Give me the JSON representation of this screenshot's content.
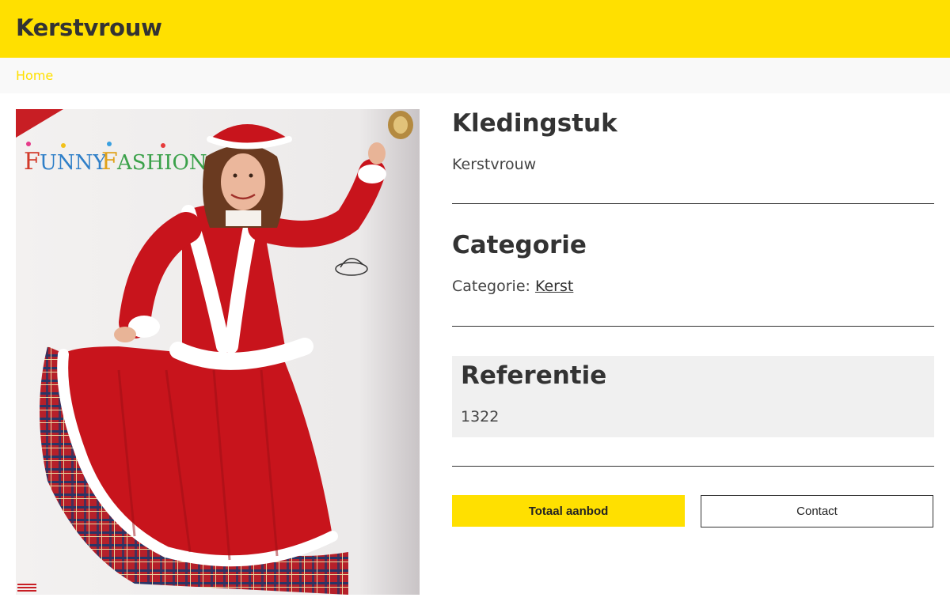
{
  "header": {
    "title": "Kerstvrouw"
  },
  "breadcrumb": {
    "home_label": "Home"
  },
  "photo": {
    "brand_text": "FUNNY FASHION"
  },
  "details": {
    "item": {
      "heading": "Kledingstuk",
      "value": "Kerstvrouw"
    },
    "category": {
      "heading": "Categorie",
      "prefix": "Categorie:",
      "link_label": "Kerst"
    },
    "reference": {
      "heading": "Referentie",
      "value": "1322"
    }
  },
  "buttons": {
    "primary_label": "Totaal aanbod",
    "secondary_label": "Contact"
  },
  "colors": {
    "accent": "#ffe000",
    "text": "#333333",
    "panel": "#f0f0f0"
  }
}
